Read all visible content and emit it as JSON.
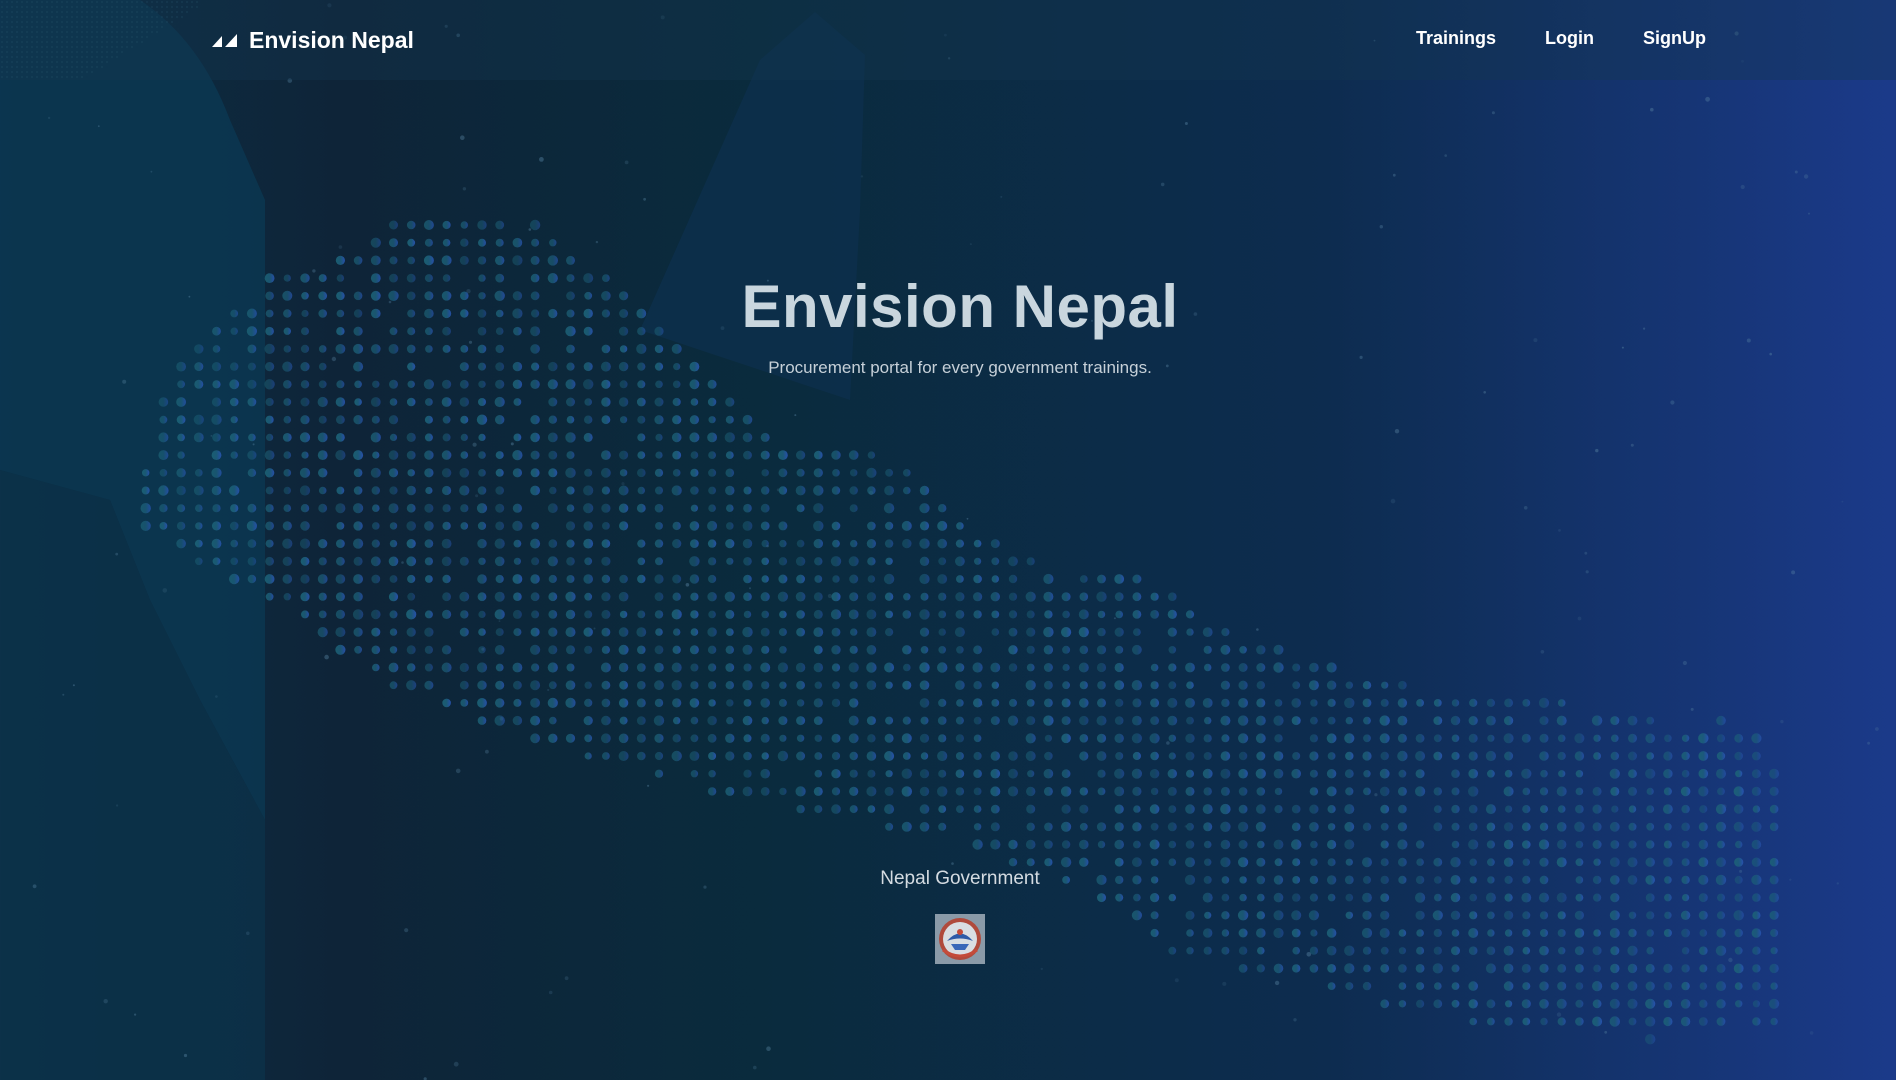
{
  "header": {
    "brand": "Envision Nepal",
    "nav": {
      "trainings": "Trainings",
      "login": "Login",
      "signup": "SignUp"
    }
  },
  "hero": {
    "title": "Envision Nepal",
    "subtitle": "Procurement portal for every government trainings."
  },
  "footer": {
    "government_label": "Nepal Government",
    "emblem_icon": "nepal-government-emblem-icon"
  },
  "colors": {
    "dot_teal": "#1e6f82",
    "dot_blue": "#2a5ab8",
    "text_light": "#c9d6de"
  }
}
